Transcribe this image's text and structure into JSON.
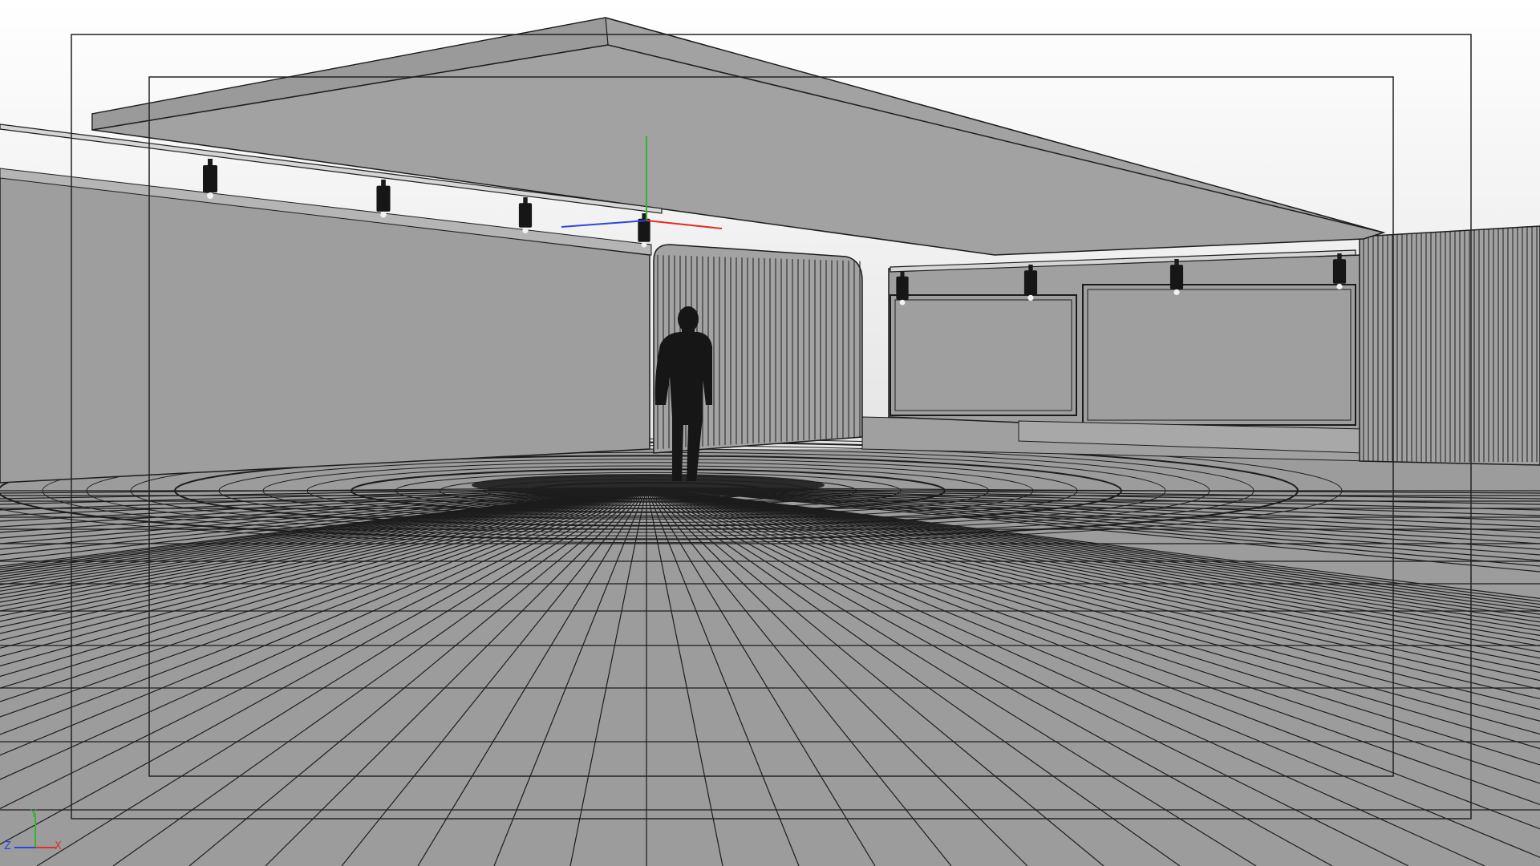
{
  "viewport": {
    "view": "perspective",
    "display_mode": "wireframe-shaded",
    "background_top": "#ffffff",
    "background_bottom": "#9a9a9a",
    "floor_color": "#9c9c9c",
    "wall_color": "#9e9e9e",
    "ceiling_color": "#a2a2a2",
    "line_color": "#1c1c1c",
    "safe_frame_color": "#222222"
  },
  "gizmo": {
    "x_axis_label": "X",
    "y_axis_label": "Y",
    "z_axis_label": "Z",
    "x_color": "#e0302a",
    "y_color": "#2fb52f",
    "z_color": "#2a48e0"
  },
  "scene_objects": {
    "person": "person-silhouette",
    "spotlight": "track-spotlight-icon",
    "slatted_wall": "curved-slatted-partition",
    "display_frame": "wall-display-frame",
    "ceiling": "ceiling-slab",
    "floor": "radial-floor-grid"
  },
  "counts": {
    "left_spotlights": 4,
    "right_spotlights": 4
  }
}
